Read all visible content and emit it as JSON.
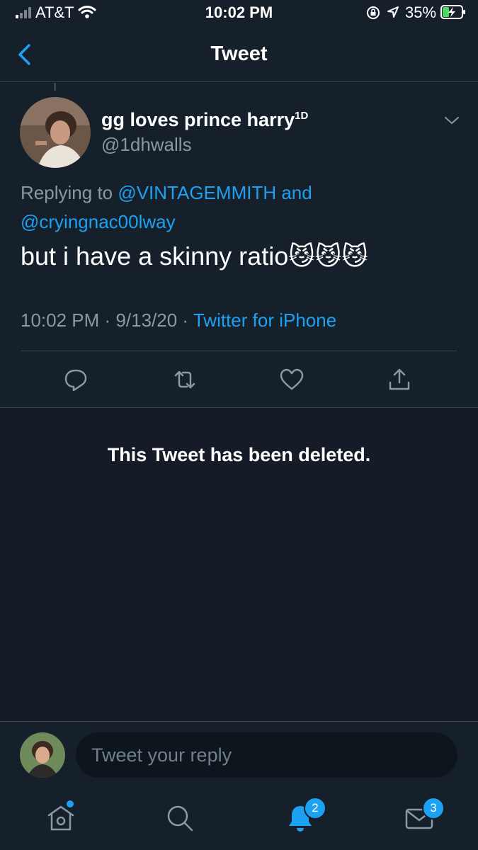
{
  "status_bar": {
    "carrier": "AT&T",
    "time": "10:02 PM",
    "battery_percent": "35%",
    "battery_level": 0.35,
    "icons": [
      "signal-bars-icon",
      "wifi-icon",
      "rotation-lock-icon",
      "location-arrow-icon",
      "battery-charging-icon"
    ]
  },
  "header": {
    "title": "Tweet",
    "back_icon": "chevron-left-icon"
  },
  "tweet": {
    "display_name": "gg loves prince harry",
    "name_suffix": "1D",
    "handle": "@1dhwalls",
    "replying_prefix": "Replying to",
    "mention_1": "@VINTAGEMMITH",
    "replying_joiner": "and",
    "mention_2": "@cryingnac00lway",
    "text": "but i have a skinny ratio😼😼😼",
    "time": "10:02 PM",
    "separator": "·",
    "date": "9/13/20",
    "source": "Twitter for iPhone",
    "actions": [
      "reply-icon",
      "retweet-icon",
      "like-icon",
      "share-icon"
    ]
  },
  "deleted_notice": "This Tweet has been deleted.",
  "composer": {
    "placeholder": "Tweet your reply"
  },
  "tabbar": {
    "items": [
      "home-icon",
      "search-icon",
      "notifications-icon",
      "messages-icon"
    ],
    "notifications_badge": "2",
    "messages_badge": "3"
  },
  "colors": {
    "background": "#15202b",
    "accent": "#1da1f2",
    "secondary_text": "#8899a6",
    "divider": "#38444d"
  }
}
